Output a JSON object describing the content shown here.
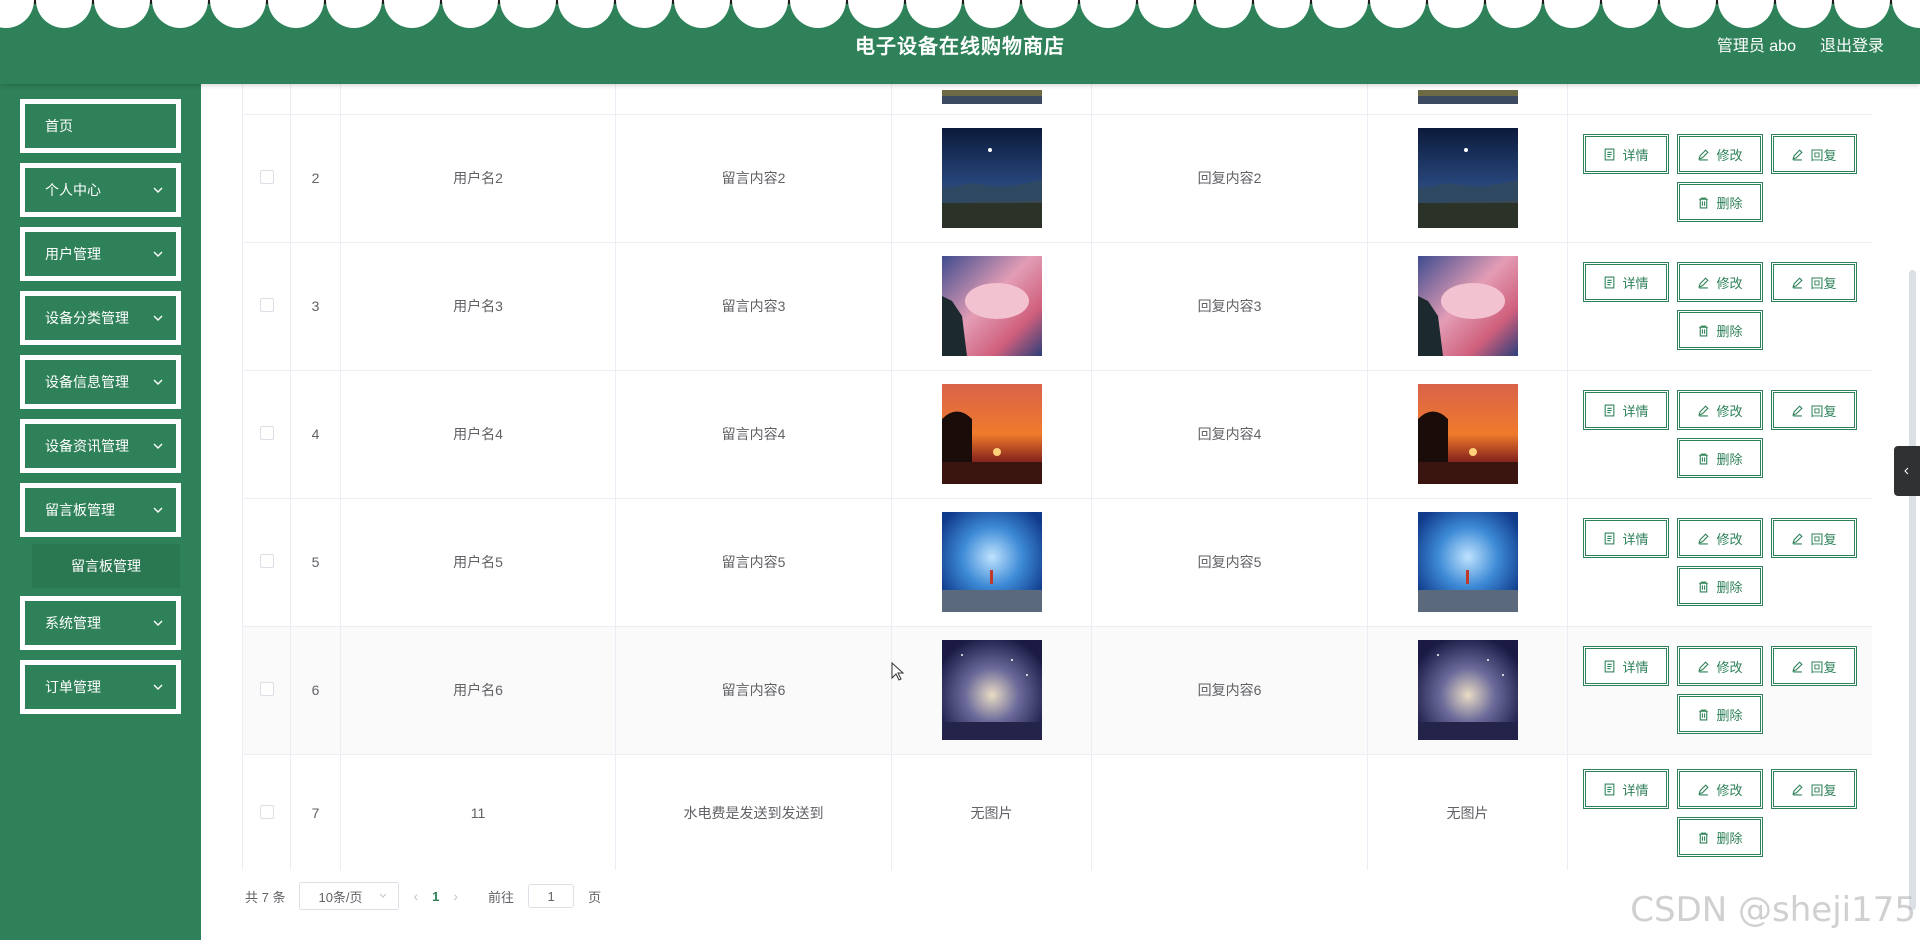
{
  "header": {
    "title": "电子设备在线购物商店",
    "user_label": "管理员 abo",
    "logout_label": "退出登录"
  },
  "sidebar": {
    "items": [
      {
        "label": "首页",
        "has_children": false
      },
      {
        "label": "个人中心",
        "has_children": true
      },
      {
        "label": "用户管理",
        "has_children": true
      },
      {
        "label": "设备分类管理",
        "has_children": true
      },
      {
        "label": "设备信息管理",
        "has_children": true
      },
      {
        "label": "设备资讯管理",
        "has_children": true
      },
      {
        "label": "留言板管理",
        "has_children": true
      },
      {
        "label": "系统管理",
        "has_children": true
      },
      {
        "label": "订单管理",
        "has_children": true
      }
    ],
    "submenu": {
      "label": "留言板管理"
    }
  },
  "table": {
    "rows": [
      {
        "index": "2",
        "username": "用户名2",
        "message": "留言内容2",
        "image": "night-landscape",
        "reply": "回复内容2",
        "reply_image": "night-landscape"
      },
      {
        "index": "3",
        "username": "用户名3",
        "message": "留言内容3",
        "image": "pink-cloud",
        "reply": "回复内容3",
        "reply_image": "pink-cloud"
      },
      {
        "index": "4",
        "username": "用户名4",
        "message": "留言内容4",
        "image": "sunset-tree",
        "reply": "回复内容4",
        "reply_image": "sunset-tree"
      },
      {
        "index": "5",
        "username": "用户名5",
        "message": "留言内容5",
        "image": "blue-sky-figure",
        "reply": "回复内容5",
        "reply_image": "blue-sky-figure"
      },
      {
        "index": "6",
        "username": "用户名6",
        "message": "留言内容6",
        "image": "starry-purple",
        "reply": "回复内容6",
        "reply_image": "starry-purple"
      },
      {
        "index": "7",
        "username": "11",
        "message": "水电费是发送到发送到",
        "image_text": "无图片",
        "reply": "",
        "reply_image_text": "无图片"
      }
    ],
    "actions": {
      "detail": "详情",
      "edit": "修改",
      "reply": "回复",
      "delete": "删除"
    }
  },
  "pagination": {
    "total": "共 7 条",
    "page_size": "10条/页",
    "current_page": "1",
    "goto_prefix": "前往",
    "goto_value": "1",
    "goto_suffix": "页"
  },
  "watermark": "CSDN @sheji175",
  "colors": {
    "brand": "#2e8158",
    "sidebar_sub": "#2a7851",
    "border": "#ebeef5"
  }
}
